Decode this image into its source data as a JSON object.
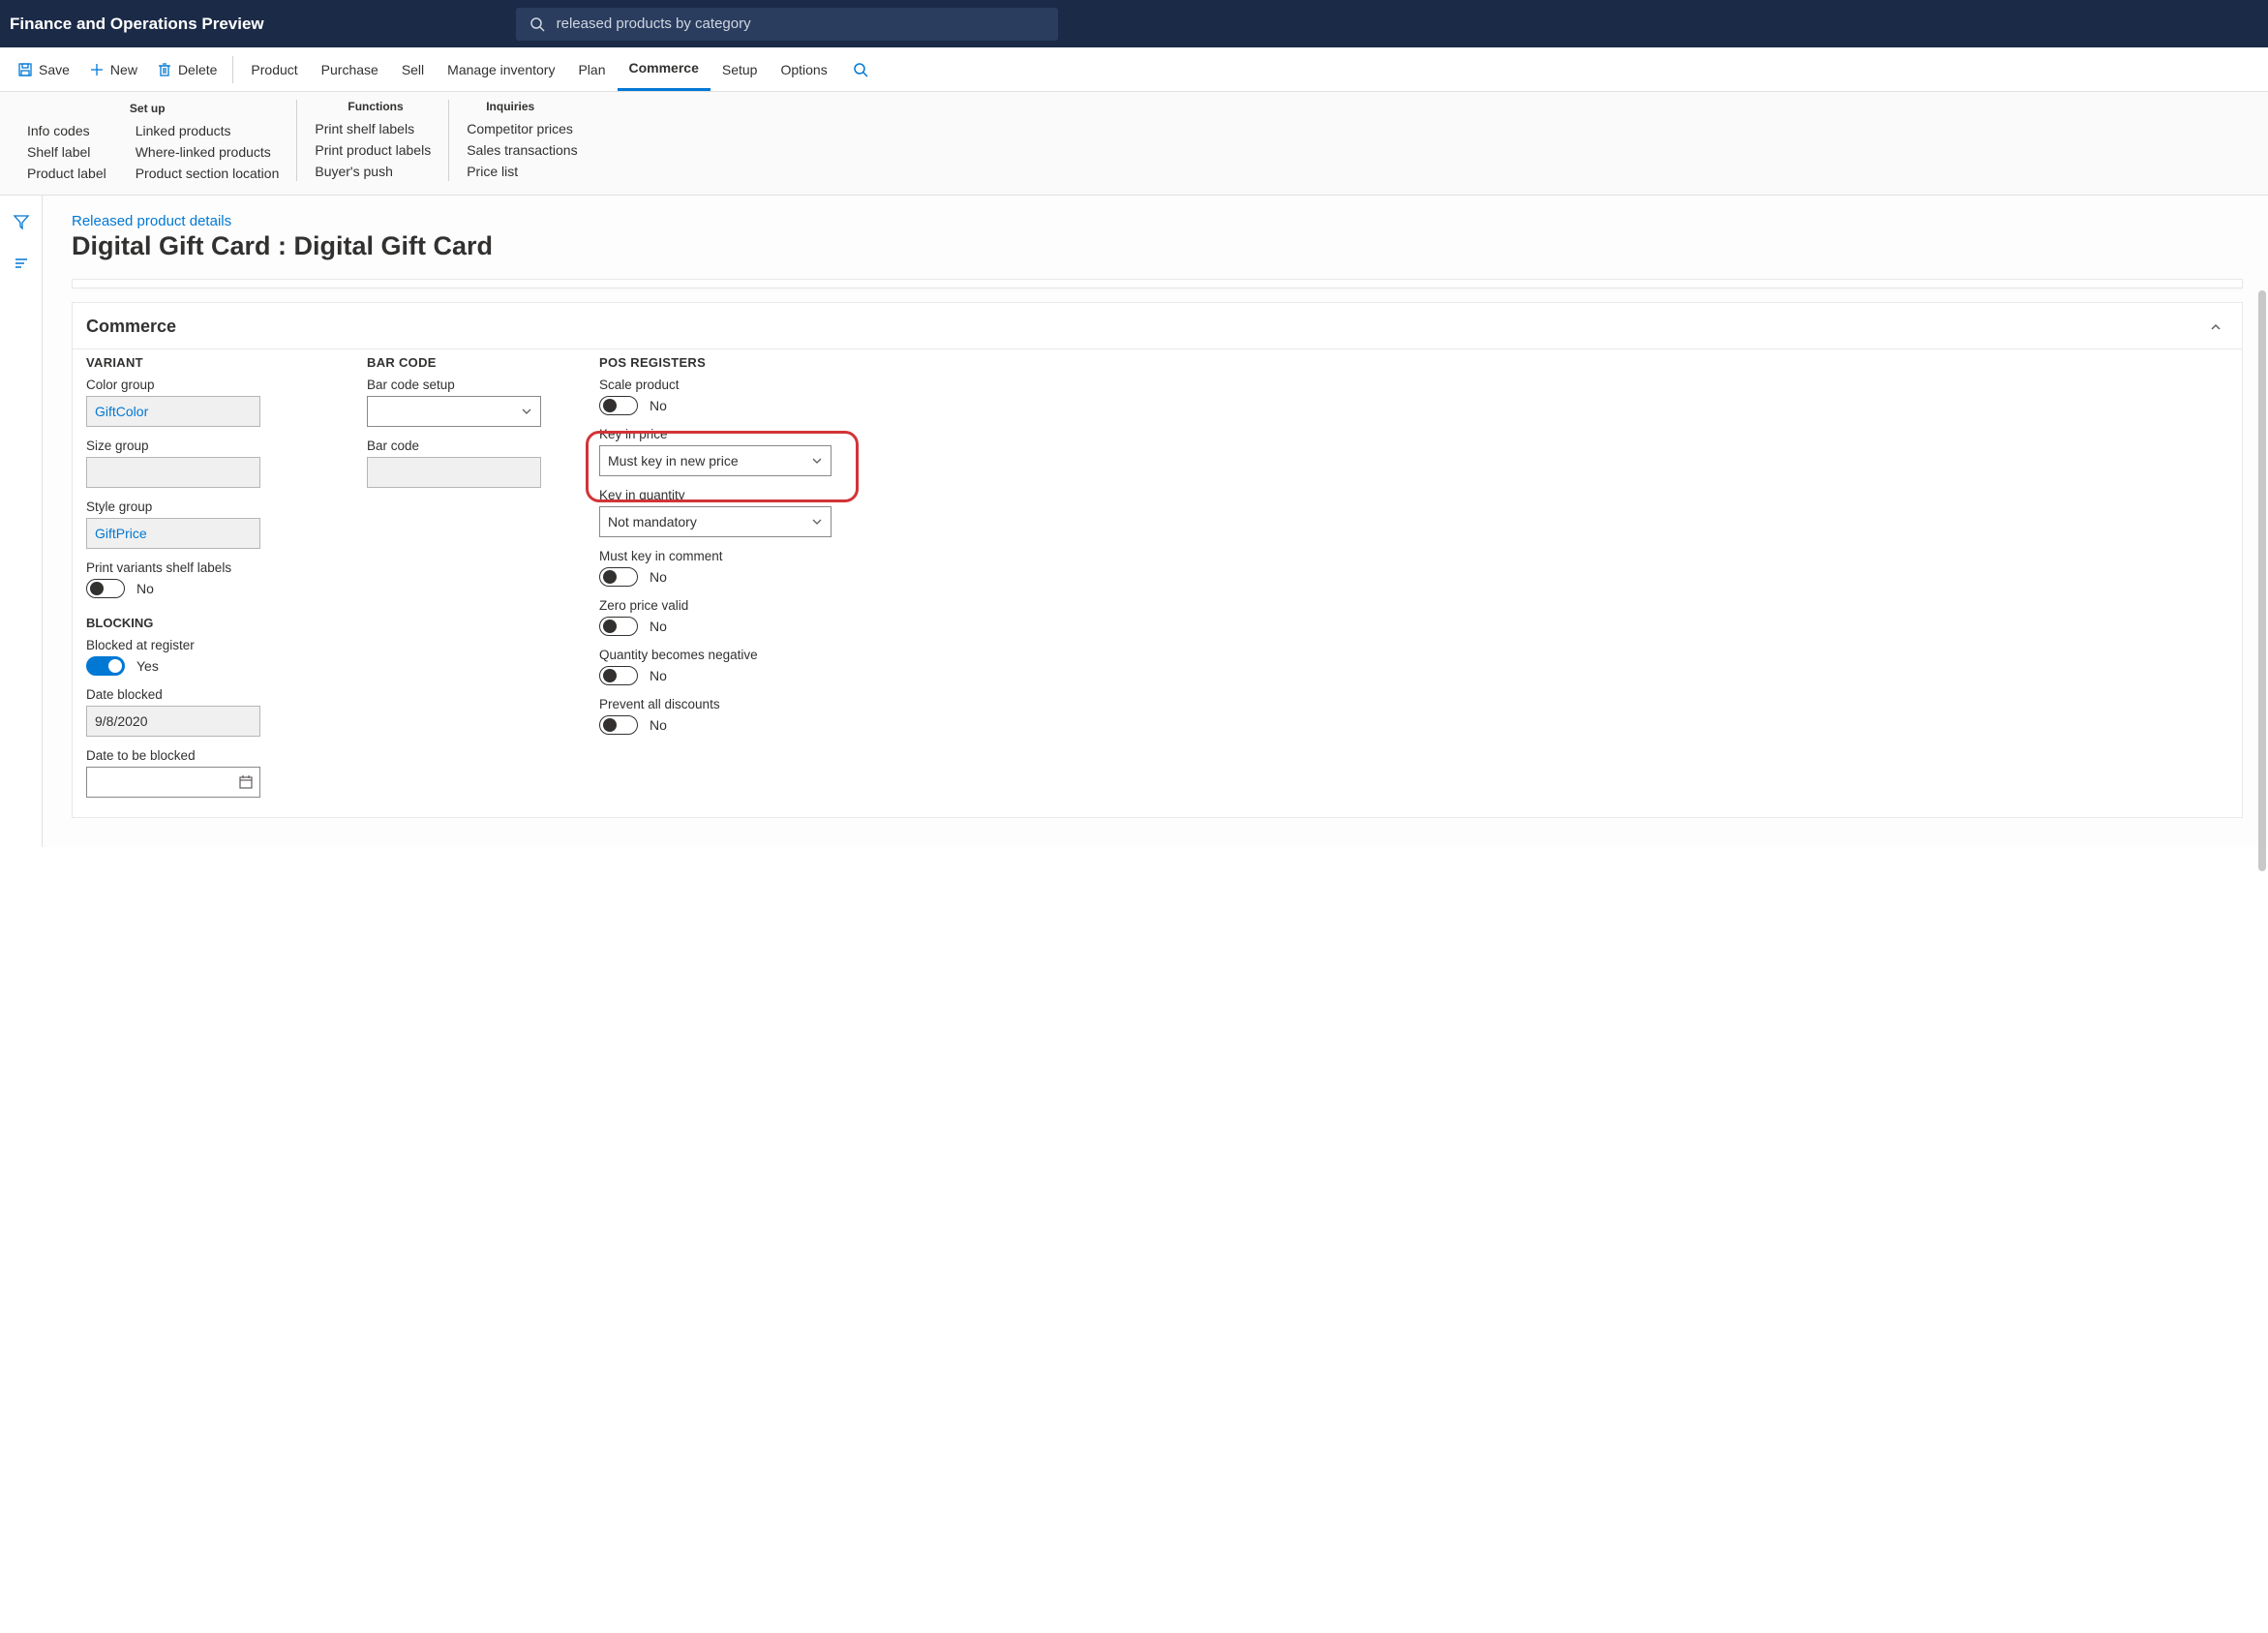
{
  "header": {
    "app_title": "Finance and Operations Preview",
    "search_value": "released products by category"
  },
  "actions": {
    "save": "Save",
    "new": "New",
    "delete": "Delete"
  },
  "tabs": {
    "product": "Product",
    "purchase": "Purchase",
    "sell": "Sell",
    "manage_inventory": "Manage inventory",
    "plan": "Plan",
    "commerce": "Commerce",
    "setup": "Setup",
    "options": "Options"
  },
  "ribbon": {
    "setup": {
      "header": "Set up",
      "col1": {
        "info_codes": "Info codes",
        "shelf_label": "Shelf label",
        "product_label": "Product label"
      },
      "col2": {
        "linked_products": "Linked products",
        "where_linked": "Where-linked products",
        "section_location": "Product section location"
      }
    },
    "functions": {
      "header": "Functions",
      "items": {
        "print_shelf": "Print shelf labels",
        "print_product": "Print product labels",
        "buyers_push": "Buyer's push"
      }
    },
    "inquiries": {
      "header": "Inquiries",
      "items": {
        "competitor_prices": "Competitor prices",
        "sales_transactions": "Sales transactions",
        "price_list": "Price list"
      }
    }
  },
  "page": {
    "breadcrumb": "Released product details",
    "title": "Digital Gift Card : Digital Gift Card"
  },
  "section": {
    "title": "Commerce",
    "variant": {
      "heading": "VARIANT",
      "color_group_label": "Color group",
      "color_group_value": "GiftColor",
      "size_group_label": "Size group",
      "size_group_value": "",
      "style_group_label": "Style group",
      "style_group_value": "GiftPrice",
      "print_variants_label": "Print variants shelf labels",
      "print_variants_value": "No"
    },
    "blocking": {
      "heading": "BLOCKING",
      "blocked_at_register_label": "Blocked at register",
      "blocked_at_register_value": "Yes",
      "date_blocked_label": "Date blocked",
      "date_blocked_value": "9/8/2020",
      "date_to_be_blocked_label": "Date to be blocked",
      "date_to_be_blocked_value": ""
    },
    "barcode": {
      "heading": "BAR CODE",
      "setup_label": "Bar code setup",
      "setup_value": "",
      "barcode_label": "Bar code",
      "barcode_value": ""
    },
    "pos": {
      "heading": "POS REGISTERS",
      "scale_product_label": "Scale product",
      "scale_product_value": "No",
      "key_in_price_label": "Key in price",
      "key_in_price_value": "Must key in new price",
      "key_in_quantity_label": "Key in quantity",
      "key_in_quantity_value": "Not mandatory",
      "must_key_comment_label": "Must key in comment",
      "must_key_comment_value": "No",
      "zero_price_valid_label": "Zero price valid",
      "zero_price_valid_value": "No",
      "qty_negative_label": "Quantity becomes negative",
      "qty_negative_value": "No",
      "prevent_discounts_label": "Prevent all discounts",
      "prevent_discounts_value": "No"
    }
  }
}
